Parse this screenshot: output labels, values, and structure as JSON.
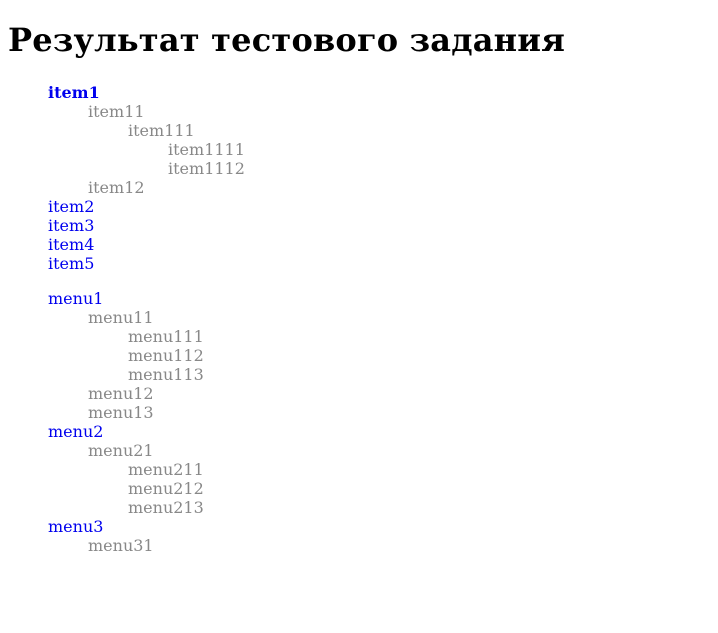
{
  "heading": "Результат тестового задания",
  "colors": {
    "top_link": "#0000ee",
    "sub_item": "#888888"
  },
  "items": {
    "item1": "item1",
    "item11": "item11",
    "item111": "item111",
    "item1111": "item1111",
    "item1112": "item1112",
    "item12": "item12",
    "item2": "item2",
    "item3": "item3",
    "item4": "item4",
    "item5": "item5"
  },
  "menus": {
    "menu1": "menu1",
    "menu11": "menu11",
    "menu111": "menu111",
    "menu112": "menu112",
    "menu113": "menu113",
    "menu12": "menu12",
    "menu13": "menu13",
    "menu2": "menu2",
    "menu21": "menu21",
    "menu211": "menu211",
    "menu212": "menu212",
    "menu213": "menu213",
    "menu3": "menu3",
    "menu31": "menu31"
  }
}
